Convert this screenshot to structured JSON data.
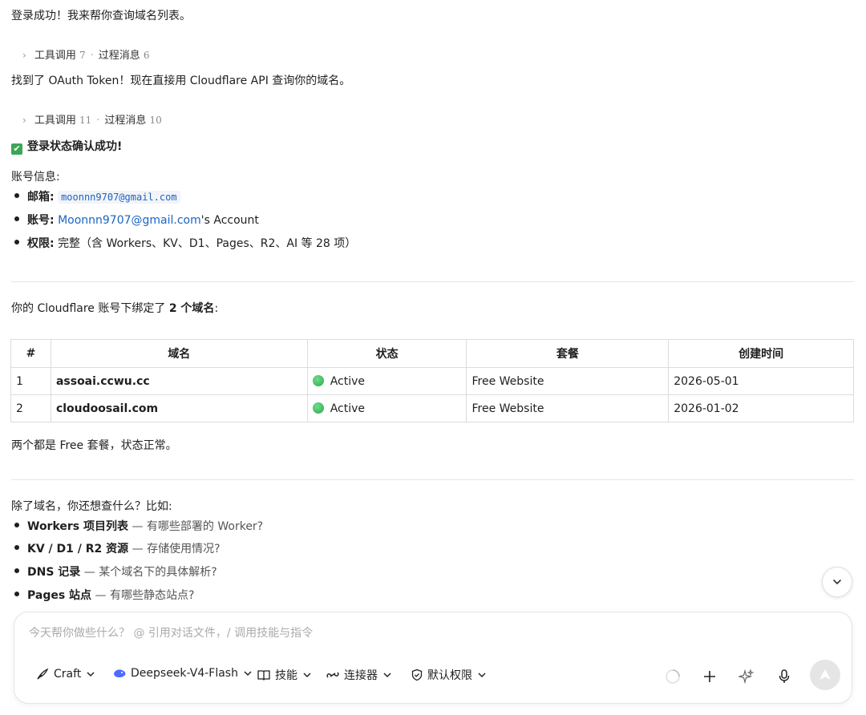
{
  "messages": {
    "intro": "登录成功！我来帮你查询域名列表。",
    "collapse1": {
      "tools_label": "工具调用",
      "tools_count": "7",
      "sep": "·",
      "msgs_label": "过程消息",
      "msgs_count": "6"
    },
    "found_token": "找到了 OAuth Token！现在直接用 Cloudflare API 查询你的域名。",
    "collapse2": {
      "tools_label": "工具调用",
      "tools_count": "11",
      "sep": "·",
      "msgs_label": "过程消息",
      "msgs_count": "10"
    },
    "confirm": "登录状态确认成功!",
    "account_heading": "账号信息:",
    "account": {
      "email_label": "邮箱:",
      "email_value": "moonnn9707@gmail.com",
      "account_label": "账号:",
      "account_link": "Moonnn9707@gmail.com",
      "account_suffix": "'s Account",
      "perm_label": "权限:",
      "perm_value": "完整（含 Workers、KV、D1、Pages、R2、AI 等 28 项）"
    },
    "domains_intro_prefix": "你的 Cloudflare 账号下绑定了 ",
    "domains_intro_bold": "2 个域名",
    "domains_intro_suffix": ":",
    "table": {
      "headers": [
        "#",
        "域名",
        "状态",
        "套餐",
        "创建时间"
      ],
      "rows": [
        {
          "num": "1",
          "domain": "assoai.ccwu.cc",
          "status": "Active",
          "plan": "Free Website",
          "created": "2026-05-01"
        },
        {
          "num": "2",
          "domain": "cloudoosail.com",
          "status": "Active",
          "plan": "Free Website",
          "created": "2026-01-02"
        }
      ]
    },
    "summary": "两个都是 Free 套餐，状态正常。",
    "followup_heading": "除了域名，你还想查什么？比如:",
    "followups": [
      {
        "bold": "Workers 项目列表",
        "rest": " — 有哪些部署的 Worker?"
      },
      {
        "bold": "KV / D1 / R2 资源",
        "rest": " — 存储使用情况?"
      },
      {
        "bold": "DNS 记录",
        "rest": " — 某个域名下的具体解析?"
      },
      {
        "bold": "Pages 站点",
        "rest": " — 有哪些静态站点?"
      }
    ]
  },
  "composer": {
    "placeholder": "今天帮你做些什么？ @ 引用对话文件，/ 调用技能与指令",
    "craft": "Craft",
    "model": "Deepseek-V4-Flash",
    "skills": "技能",
    "connectors": "连接器",
    "permissions": "默认权限"
  },
  "colors": {
    "link": "#1a64c4",
    "status_green": "#2ea84f",
    "check_green": "#3aa757"
  }
}
